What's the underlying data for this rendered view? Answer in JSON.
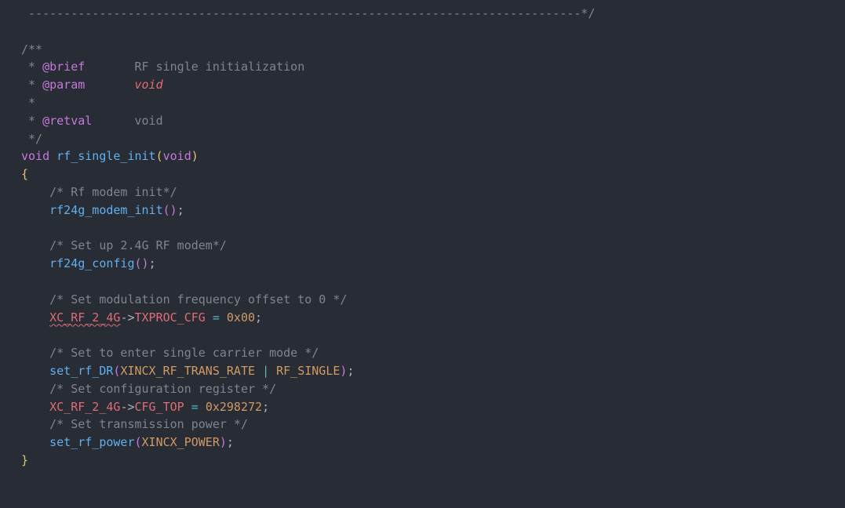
{
  "editor": {
    "theme_background": "#282c34",
    "lines": [
      [
        {
          "t": " ------------------------------------------------------------------------------*/",
          "c": "comment"
        }
      ],
      [],
      [
        {
          "t": "/**",
          "c": "comment"
        }
      ],
      [
        {
          "t": " * ",
          "c": "comment"
        },
        {
          "t": "@brief",
          "c": "tag"
        },
        {
          "t": "       RF single initialization",
          "c": "comment"
        }
      ],
      [
        {
          "t": " * ",
          "c": "comment"
        },
        {
          "t": "@param",
          "c": "tag"
        },
        {
          "t": "       ",
          "c": "comment"
        },
        {
          "t": "void",
          "c": "italic-param"
        }
      ],
      [
        {
          "t": " *",
          "c": "comment"
        }
      ],
      [
        {
          "t": " * ",
          "c": "comment"
        },
        {
          "t": "@retval",
          "c": "tag"
        },
        {
          "t": "      void",
          "c": "comment"
        }
      ],
      [
        {
          "t": " */",
          "c": "comment"
        }
      ],
      [
        {
          "t": "void",
          "c": "type"
        },
        {
          "t": " ",
          "c": "punc"
        },
        {
          "t": "rf_single_init",
          "c": "func"
        },
        {
          "t": "(",
          "c": "paren-a"
        },
        {
          "t": "void",
          "c": "type"
        },
        {
          "t": ")",
          "c": "paren-a"
        }
      ],
      [
        {
          "t": "{",
          "c": "brace"
        }
      ],
      [
        {
          "t": "    ",
          "c": "punc"
        },
        {
          "t": "/* Rf modem init*/",
          "c": "comment"
        }
      ],
      [
        {
          "t": "    ",
          "c": "punc"
        },
        {
          "t": "rf24g_modem_init",
          "c": "func"
        },
        {
          "t": "()",
          "c": "paren-b"
        },
        {
          "t": ";",
          "c": "punc"
        }
      ],
      [],
      [
        {
          "t": "    ",
          "c": "punc"
        },
        {
          "t": "/* Set up 2.4G RF modem*/",
          "c": "comment"
        }
      ],
      [
        {
          "t": "    ",
          "c": "punc"
        },
        {
          "t": "rf24g_config",
          "c": "func"
        },
        {
          "t": "()",
          "c": "paren-b"
        },
        {
          "t": ";",
          "c": "punc"
        }
      ],
      [],
      [
        {
          "t": "    ",
          "c": "punc"
        },
        {
          "t": "/* Set modulation frequency offset to 0 */",
          "c": "comment"
        }
      ],
      [
        {
          "t": "    ",
          "c": "punc"
        },
        {
          "t": "XC_RF_2_4G",
          "c": "var",
          "squiggle": true
        },
        {
          "t": "->",
          "c": "punc"
        },
        {
          "t": "TXPROC_CFG",
          "c": "var"
        },
        {
          "t": " ",
          "c": "punc"
        },
        {
          "t": "=",
          "c": "op"
        },
        {
          "t": " ",
          "c": "punc"
        },
        {
          "t": "0x00",
          "c": "num"
        },
        {
          "t": ";",
          "c": "punc"
        }
      ],
      [],
      [
        {
          "t": "    ",
          "c": "punc"
        },
        {
          "t": "/* Set to enter single carrier mode */",
          "c": "comment"
        }
      ],
      [
        {
          "t": "    ",
          "c": "punc"
        },
        {
          "t": "set_rf_DR",
          "c": "func"
        },
        {
          "t": "(",
          "c": "paren-b"
        },
        {
          "t": "XINCX_RF_TRANS_RATE",
          "c": "const"
        },
        {
          "t": " ",
          "c": "punc"
        },
        {
          "t": "|",
          "c": "op"
        },
        {
          "t": " ",
          "c": "punc"
        },
        {
          "t": "RF_SINGLE",
          "c": "const"
        },
        {
          "t": ")",
          "c": "paren-b"
        },
        {
          "t": ";",
          "c": "punc"
        }
      ],
      [
        {
          "t": "    ",
          "c": "punc"
        },
        {
          "t": "/* Set configuration register */",
          "c": "comment"
        }
      ],
      [
        {
          "t": "    ",
          "c": "punc"
        },
        {
          "t": "XC_RF_2_4G",
          "c": "var"
        },
        {
          "t": "->",
          "c": "punc"
        },
        {
          "t": "CFG_TOP",
          "c": "var"
        },
        {
          "t": " ",
          "c": "punc"
        },
        {
          "t": "=",
          "c": "op"
        },
        {
          "t": " ",
          "c": "punc"
        },
        {
          "t": "0x298272",
          "c": "num"
        },
        {
          "t": ";",
          "c": "punc"
        }
      ],
      [
        {
          "t": "    ",
          "c": "punc"
        },
        {
          "t": "/* Set transmission power */",
          "c": "comment"
        }
      ],
      [
        {
          "t": "    ",
          "c": "punc"
        },
        {
          "t": "set_rf_power",
          "c": "func"
        },
        {
          "t": "(",
          "c": "paren-b"
        },
        {
          "t": "XINCX_POWER",
          "c": "const"
        },
        {
          "t": ")",
          "c": "paren-b"
        },
        {
          "t": ";",
          "c": "punc"
        }
      ],
      [
        {
          "t": "}",
          "c": "brace"
        }
      ]
    ]
  }
}
